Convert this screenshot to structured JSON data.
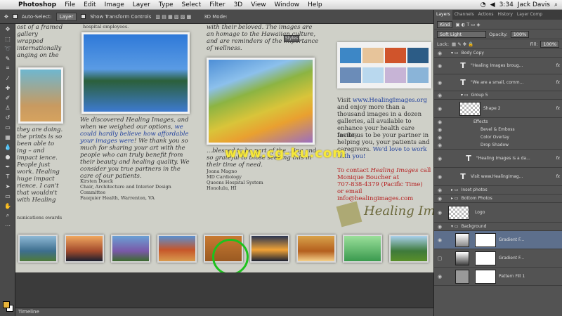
{
  "menubar": {
    "app": "Photoshop",
    "items": [
      "File",
      "Edit",
      "Image",
      "Layer",
      "Type",
      "Select",
      "Filter",
      "3D",
      "View",
      "Window",
      "Help"
    ],
    "time": "3:34",
    "user": "Jack Davis"
  },
  "options": {
    "auto_select": "Auto-Select:",
    "layer_value": "Layer",
    "show_transform": "Show Transform Controls",
    "mode3d": "3D Mode:"
  },
  "canvas": {
    "left_col_top": "ost of a framed gallery wrapped internationally anging on the",
    "left_col_mid": "they are doing. the prints is so been able to ing – and impact ience. People just work. Healing huge impact rience. I can't that wouldn't with Healing",
    "left_col_bottom": "nunications ewards",
    "mid_top": "hospital employees.",
    "center_quote_1": "We discovered Healing Images, and when we weighed our options, ",
    "center_quote_hl": "we could hardly believe how affordable your images were",
    "center_quote_2": "! We thank you so much for sharing your art with the people who can truly benefit from their beauty and healing quality. We consider you true partners in the care of our patients.",
    "center_sig": "Kirsten Dueck\nChair, Architecture and Interior Design Committee\nFauquier Health, Warrenton, VA",
    "right_top": "with their beloved. The images are an homage to the Hawaiian culture, and are reminders of the importance of wellness.",
    "right_quote": "...blessed to be part of the ...ing and so grateful to those seeking this in their time of need.",
    "right_sig": "Joana Magno\nMD Cardiology\nQueens Hospital System\nHonolulu, HI",
    "visit_1": "Visit ",
    "visit_link": "www.HealingImages.org",
    "visit_2": " and enjoy more than a thousand images in a dozen galleries, all available to enhance your health care facility.",
    "invite": "Invite us to be your partner in helping you, your patients and caregivers.",
    "invite_hl": "We'd love to work with you!",
    "contact_1": "To contact ",
    "contact_em": "Healing Images",
    "contact_2": " call Monique Boucher at",
    "contact_phone": "707-838-4379 (Pacific Time)",
    "contact_email": "or email info@healingimages.com",
    "logo_text": "Healing Images",
    "styles_tab": "Styles",
    "watermark": "www.cg-ku.com"
  },
  "timeline": "Timeline",
  "panel": {
    "tabs": [
      "Layers",
      "Channels",
      "Actions",
      "History",
      "Layer Comp"
    ],
    "kind": "Kind",
    "blend_mode": "Soft Light",
    "opacity_label": "Opacity:",
    "opacity": "100%",
    "lock_label": "Lock:",
    "fill_label": "Fill:",
    "fill": "100%",
    "layers": [
      {
        "name": "Body Copy",
        "kind": "group"
      },
      {
        "name": "\"Healing Images broug...",
        "kind": "text"
      },
      {
        "name": "\"We are a small, comm...",
        "kind": "text"
      },
      {
        "name": "Group 5",
        "kind": "group"
      },
      {
        "name": "Shape 2",
        "kind": "shape"
      },
      {
        "name": "Effects",
        "kind": "effect"
      },
      {
        "name": "Bevel & Emboss",
        "kind": "effect"
      },
      {
        "name": "Color Overlay",
        "kind": "effect"
      },
      {
        "name": "Drop Shadow",
        "kind": "effect"
      },
      {
        "name": "\"Healing Images is a da...",
        "kind": "text"
      },
      {
        "name": "Visit www.HealingImag...",
        "kind": "text"
      },
      {
        "name": "Inset photos",
        "kind": "group"
      },
      {
        "name": "Bottom Photos",
        "kind": "group"
      },
      {
        "name": "Logo",
        "kind": "pixel"
      },
      {
        "name": "Background",
        "kind": "group"
      },
      {
        "name": "Gradient F...",
        "kind": "adjust"
      },
      {
        "name": "Gradient F...",
        "kind": "adjust"
      },
      {
        "name": "Pattern Fill 1",
        "kind": "adjust"
      }
    ]
  }
}
